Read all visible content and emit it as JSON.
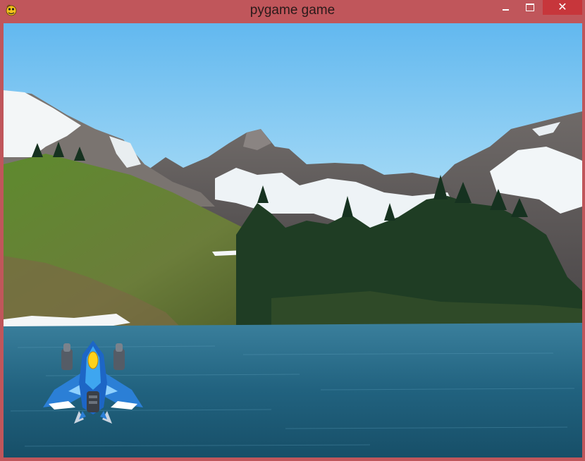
{
  "window": {
    "title": "pygame game",
    "controls": {
      "minimize": "minimize-icon",
      "maximize": "maximize-icon",
      "close": "close-icon"
    },
    "app_icon": "pygame-snake-icon"
  },
  "scene": {
    "background": "mountain-lake-photo",
    "sprites": [
      {
        "name": "player-spaceship",
        "icon": "spaceship-sprite"
      }
    ]
  },
  "colors": {
    "titlebar": "#c0565b",
    "close_button": "#c7363b",
    "sky": "#8ecbf0",
    "water": "#2a6a8a"
  }
}
